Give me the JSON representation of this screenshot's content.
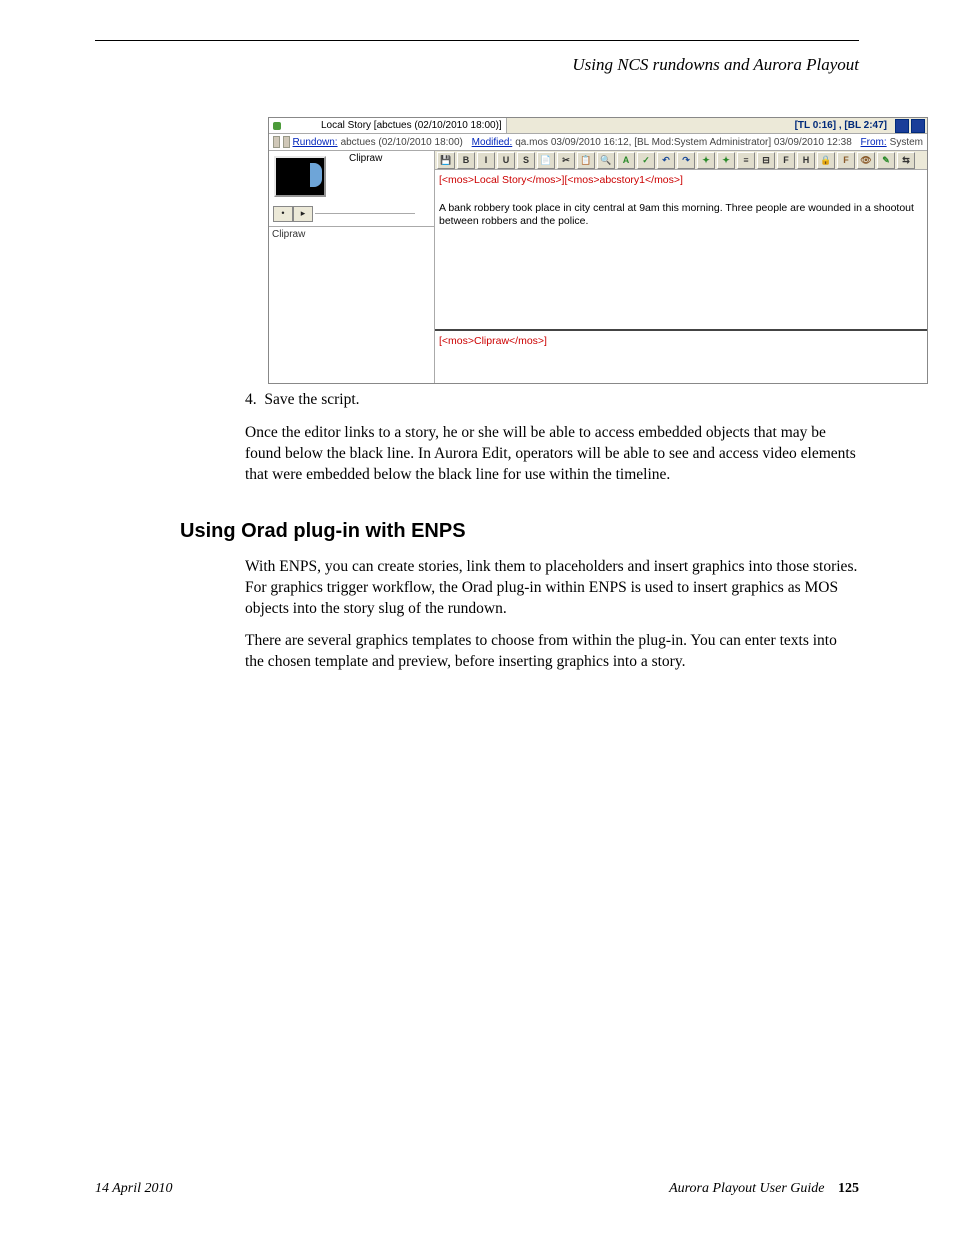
{
  "running_header": "Using NCS rundowns and Aurora Playout",
  "screenshot": {
    "title_left": "Local Story [abctues (02/10/2010 18:00)]",
    "tl_bl": "[TL 0:16] , [BL 2:47]",
    "info": {
      "rundown_label": "Rundown:",
      "rundown_value": "abctues (02/10/2010 18:00)",
      "modified_label": "Modified:",
      "modified_value": "qa.mos   03/09/2010 16:12, [BL Mod:System Administrator]  03/09/2010 12:38",
      "from_label": "From:",
      "from_value": "System"
    },
    "clip_label_top": "Clipraw",
    "clip_label_side": "Clipraw",
    "nav_dot": "•",
    "nav_arrow": "▸",
    "toolbar": [
      "💾",
      "B",
      "I",
      "U",
      "S",
      "📄",
      "✂",
      "📋",
      "🔍",
      "A",
      "✓",
      "↶",
      "↷",
      "✦",
      "✦",
      "≡",
      "⊟",
      "F",
      "H",
      "🔒",
      "F",
      "👁",
      "✎",
      "⇆"
    ],
    "mos_line_top": "[<mos>Local Story</mos>][<mos>abcstory1</mos>]",
    "body_text": "A bank robbery took place in city central at 9am this morning. Three people are wounded in a shootout between robbers and the police.",
    "mos_line_bottom": "[<mos>Clipraw</mos>]"
  },
  "step_number": "4.",
  "step_text": "Save the script.",
  "para1": "Once the editor links to a story, he or she will be able to access embedded objects that may be found below the black line. In Aurora Edit, operators will be able to see and access video elements that were embedded below the black line for use within the timeline.",
  "h2": "Using Orad plug-in with ENPS",
  "para2": "With ENPS, you can create stories, link them to placeholders and insert graphics into those stories. For graphics trigger workflow, the Orad plug-in within ENPS is used to insert graphics as MOS objects into the story slug of the rundown.",
  "para3": "There are several graphics templates to choose from within the plug-in. You can enter texts into the chosen template and preview, before inserting graphics into a story.",
  "footer": {
    "date": "14 April 2010",
    "guide": "Aurora Playout User Guide",
    "page": "125"
  }
}
